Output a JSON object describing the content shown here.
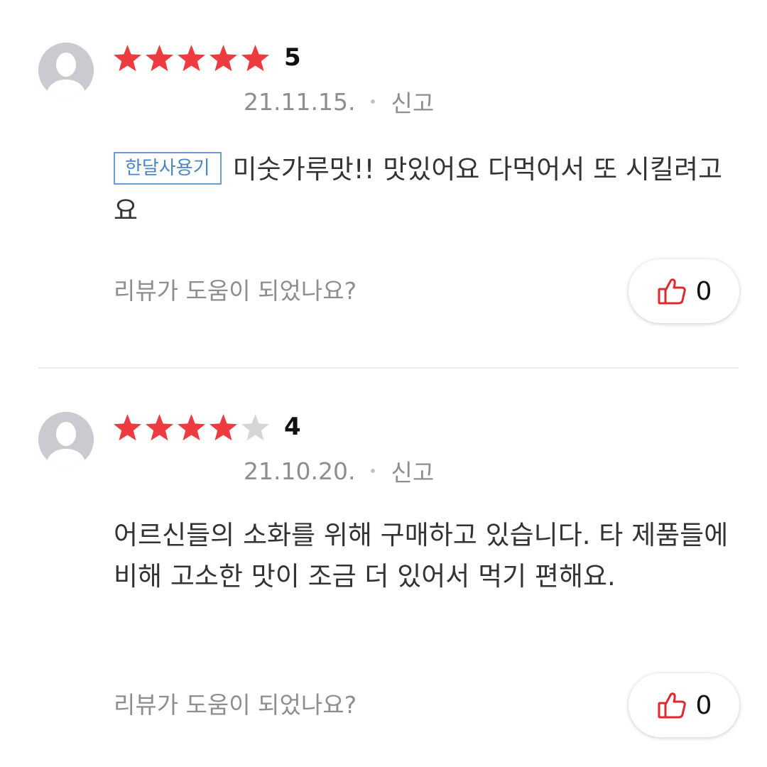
{
  "reviews": [
    {
      "rating": 5,
      "stars_filled": 5,
      "date": "21.11.15.",
      "report_label": "신고",
      "badge": "한달사용기",
      "text": "미숫가루맛!! 맛있어요 다먹어서 또 시킬려고요",
      "helpful_question": "리뷰가 도움이 되었나요?",
      "like_count": "0"
    },
    {
      "rating": 4,
      "stars_filled": 4,
      "date": "21.10.20.",
      "report_label": "신고",
      "text": "어르신들의 소화를 위해 구매하고 있습니다. 타 제품들에 비해 고소한 맛이 조금 더 있어서 먹기 편해요.",
      "helpful_question": "리뷰가 도움이 되었나요?",
      "like_count": "0"
    }
  ],
  "colors": {
    "star_filled": "#ee3b3f",
    "star_empty": "#d6d6d6",
    "badge": "#4a86c6",
    "thumb_icon": "#e0282e"
  },
  "icons": {
    "avatar": "person-silhouette-icon",
    "star": "star-icon",
    "like": "thumbs-up-icon"
  }
}
